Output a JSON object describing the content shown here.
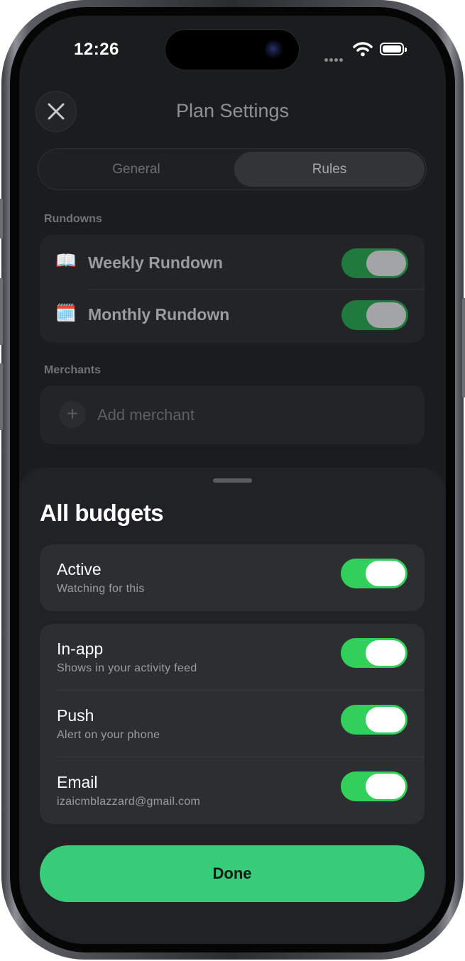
{
  "status_bar": {
    "time": "12:26"
  },
  "nav": {
    "title": "Plan Settings",
    "close_icon": "close-icon"
  },
  "segmented": {
    "tabs": [
      {
        "label": "General",
        "selected": false
      },
      {
        "label": "Rules",
        "selected": true
      }
    ]
  },
  "rundowns": {
    "section_label": "Rundowns",
    "items": [
      {
        "emoji": "📖",
        "label": "Weekly Rundown",
        "enabled": true
      },
      {
        "emoji": "🗓️",
        "label": "Monthly Rundown",
        "enabled": true
      }
    ]
  },
  "merchants": {
    "section_label": "Merchants",
    "add_label": "Add merchant",
    "add_icon": "+"
  },
  "sheet": {
    "title": "All budgets",
    "active": {
      "label": "Active",
      "subtitle": "Watching for this",
      "enabled": true
    },
    "channels": [
      {
        "label": "In-app",
        "subtitle": "Shows in your activity feed",
        "enabled": true
      },
      {
        "label": "Push",
        "subtitle": "Alert on your phone",
        "enabled": true
      },
      {
        "label": "Email",
        "subtitle": "izaicmblazzard@gmail.com",
        "enabled": true
      }
    ],
    "done_label": "Done"
  },
  "colors": {
    "toggle_on": "#32d05b",
    "done_button": "#38cb7a",
    "sheet_bg": "#212225",
    "screen_bg": "#1b1c1e"
  }
}
